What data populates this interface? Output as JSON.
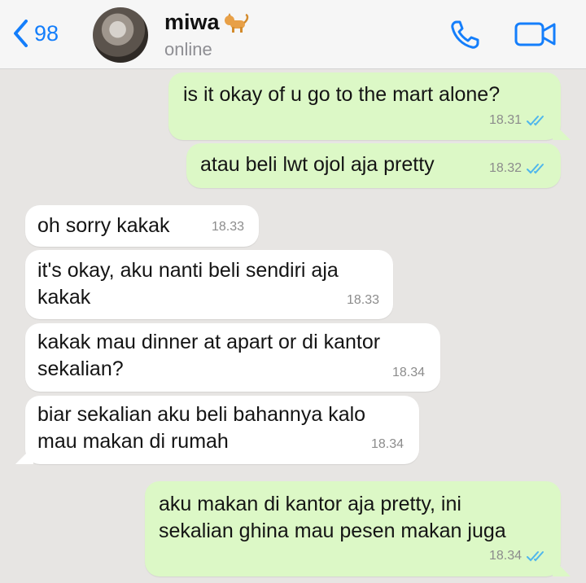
{
  "header": {
    "back_count": "98",
    "contact_name": "miwa",
    "contact_emoji": "cat-emoji",
    "status": "online",
    "icons": [
      "chevron-left-icon",
      "avatar",
      "cat-icon",
      "phone-icon",
      "video-icon"
    ],
    "accent_color": "#147efb"
  },
  "messages": [
    {
      "direction": "out",
      "text": "is it okay of u go to the mart alone?",
      "time": "18.31",
      "ticks": "double-check"
    },
    {
      "direction": "out",
      "text": "atau beli lwt ojol aja pretty",
      "time": "18.32",
      "ticks": "double-check"
    },
    {
      "direction": "in",
      "text": "oh sorry kakak",
      "time": "18.33"
    },
    {
      "direction": "in",
      "text": "it's okay, aku nanti beli sendiri aja\nkakak",
      "time": "18.33"
    },
    {
      "direction": "in",
      "text": "kakak mau dinner at apart or di kantor\nsekalian?",
      "time": "18.34"
    },
    {
      "direction": "in",
      "text": "biar sekalian aku beli bahannya kalo\nmau makan di rumah",
      "time": "18.34"
    },
    {
      "direction": "out",
      "text": "aku makan di kantor aja pretty, ini\nsekalian ghina mau pesen makan juga",
      "time": "18.34",
      "ticks": "double-check"
    }
  ],
  "colors": {
    "chat_background": "#e7e5e3",
    "outgoing_bubble": "#dcf8c6",
    "incoming_bubble": "#ffffff",
    "read_ticks": "#4fb6ec"
  }
}
